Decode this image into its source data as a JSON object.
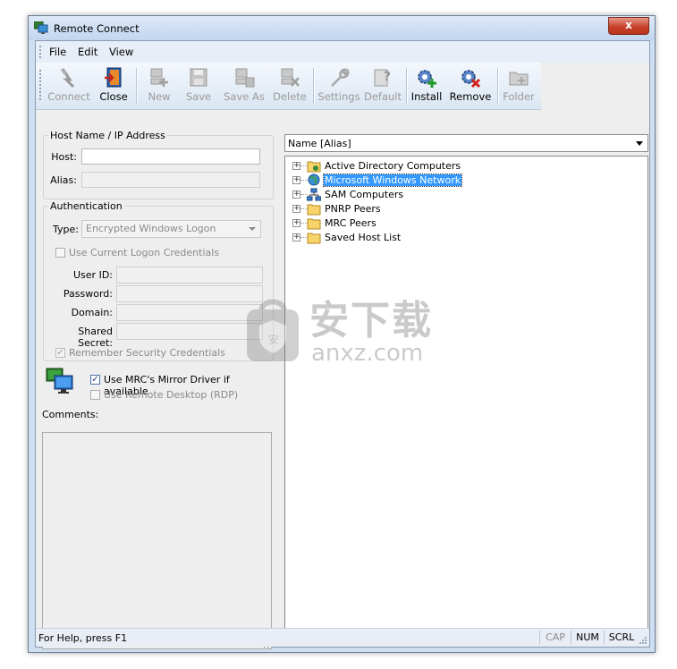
{
  "window": {
    "title": "Remote Connect",
    "close_glyph": "x"
  },
  "menu": [
    {
      "label": "File",
      "mnemonic_first": true
    },
    {
      "label": "Edit"
    },
    {
      "label": "View"
    }
  ],
  "toolbar": {
    "buttons": [
      {
        "label": "Connect",
        "icon": "connect-icon",
        "enabled": false
      },
      {
        "label": "Close",
        "icon": "close-door-icon",
        "enabled": true
      },
      {
        "label": "New",
        "icon": "new-host-icon",
        "enabled": false
      },
      {
        "label": "Save",
        "icon": "save-disk-icon",
        "enabled": false
      },
      {
        "label": "Save As",
        "icon": "save-as-icon",
        "enabled": false
      },
      {
        "label": "Delete",
        "icon": "delete-host-icon",
        "enabled": false
      },
      {
        "label": "Settings",
        "icon": "wrench-icon",
        "enabled": false
      },
      {
        "label": "Default",
        "icon": "default-help-icon",
        "enabled": false
      },
      {
        "label": "Install",
        "icon": "install-gear-icon",
        "enabled": true
      },
      {
        "label": "Remove",
        "icon": "remove-gear-icon",
        "enabled": true
      },
      {
        "label": "Folder",
        "icon": "folder-icon",
        "enabled": false
      }
    ]
  },
  "host_group": {
    "title": "Host Name / IP Address",
    "host_label": "Host:",
    "host_value": "",
    "alias_label": "Alias:",
    "alias_value": ""
  },
  "auth_group": {
    "title": "Authentication",
    "type_label": "Type:",
    "type_value": "Encrypted Windows Logon",
    "use_current": "Use Current Logon Credentials",
    "user_id_label": "User ID:",
    "password_label": "Password:",
    "domain_label": "Domain:",
    "shared_secret_label": "Shared Secret:",
    "remember": "Remember Security Credentials",
    "remember_checked": true
  },
  "driver": {
    "mirror_label": "Use MRC's Mirror Driver if available",
    "mirror_checked": true,
    "rdp_label": "Use Remote Desktop (RDP)",
    "rdp_checked": false
  },
  "comments_label": "Comments:",
  "view_combo": {
    "value": "Name [Alias]"
  },
  "tree": {
    "nodes": [
      {
        "label": "Active Directory Computers",
        "icon": "active-directory-folder-icon",
        "selected": false
      },
      {
        "label": "Microsoft Windows Network",
        "icon": "network-globe-icon",
        "selected": true
      },
      {
        "label": "SAM Computers",
        "icon": "sam-network-icon",
        "selected": false
      },
      {
        "label": "PNRP Peers",
        "icon": "folder-icon",
        "selected": false
      },
      {
        "label": "MRC Peers",
        "icon": "folder-icon",
        "selected": false
      },
      {
        "label": "Saved Host List",
        "icon": "folder-icon",
        "selected": false
      }
    ]
  },
  "status": {
    "text": "For Help, press F1",
    "indicators": [
      "CAP",
      "NUM",
      "SCRL"
    ]
  },
  "watermark": {
    "cn": "安下载",
    "domain": "anxz.com"
  }
}
